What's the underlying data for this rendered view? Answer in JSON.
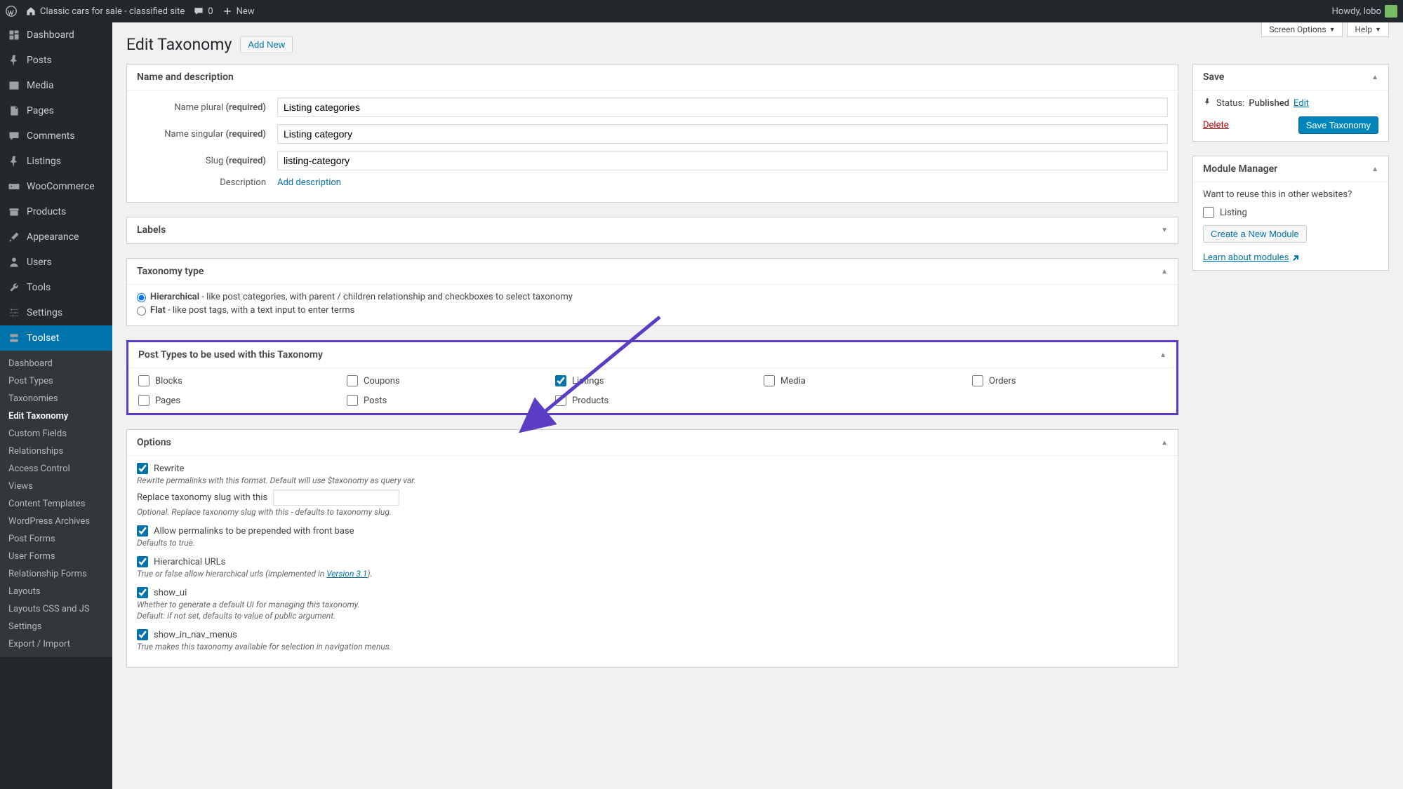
{
  "admin_bar": {
    "site_title": "Classic cars for sale - classified site",
    "comments_count": "0",
    "new_label": "New",
    "howdy": "Howdy, lobo"
  },
  "sidebar": {
    "items": [
      {
        "key": "dashboard",
        "label": "Dashboard",
        "icon": "dashboard-icon"
      },
      {
        "key": "posts",
        "label": "Posts",
        "icon": "pin-icon"
      },
      {
        "key": "media",
        "label": "Media",
        "icon": "media-icon"
      },
      {
        "key": "pages",
        "label": "Pages",
        "icon": "page-icon"
      },
      {
        "key": "comments",
        "label": "Comments",
        "icon": "comment-icon"
      },
      {
        "key": "listings",
        "label": "Listings",
        "icon": "pin-icon"
      },
      {
        "key": "woocommerce",
        "label": "WooCommerce",
        "icon": "woo-icon"
      },
      {
        "key": "products",
        "label": "Products",
        "icon": "archive-icon"
      },
      {
        "key": "appearance",
        "label": "Appearance",
        "icon": "brush-icon"
      },
      {
        "key": "users",
        "label": "Users",
        "icon": "user-icon"
      },
      {
        "key": "tools",
        "label": "Tools",
        "icon": "wrench-icon"
      },
      {
        "key": "settings",
        "label": "Settings",
        "icon": "sliders-icon"
      },
      {
        "key": "toolset",
        "label": "Toolset",
        "icon": "toolset-icon",
        "current": true
      }
    ],
    "toolset_sub": [
      "Dashboard",
      "Post Types",
      "Taxonomies",
      "Edit Taxonomy",
      "Custom Fields",
      "Relationships",
      "Access Control",
      "Views",
      "Content Templates",
      "WordPress Archives",
      "Post Forms",
      "User Forms",
      "Relationship Forms",
      "Layouts",
      "Layouts CSS and JS",
      "Settings",
      "Export / Import"
    ],
    "toolset_sub_active": "Edit Taxonomy"
  },
  "top_tabs": {
    "screen_options": "Screen Options",
    "help": "Help"
  },
  "page": {
    "title": "Edit Taxonomy",
    "add_new": "Add New"
  },
  "panels": {
    "name_desc": {
      "title": "Name and description",
      "name_plural_label": "Name plural",
      "name_singular_label": "Name singular",
      "slug_label": "Slug",
      "required": "(required)",
      "description_label": "Description",
      "add_description": "Add description",
      "values": {
        "name_plural": "Listing categories",
        "name_singular": "Listing category",
        "slug": "listing-category"
      }
    },
    "labels": {
      "title": "Labels"
    },
    "taxonomy_type": {
      "title": "Taxonomy type",
      "hierarchical_label": "Hierarchical",
      "hierarchical_desc": " - like post categories, with parent / children relationship and checkboxes to select taxonomy",
      "flat_label": "Flat",
      "flat_desc": " - like post tags, with a text input to enter terms",
      "selected": "hierarchical"
    },
    "post_types": {
      "title": "Post Types to be used with this Taxonomy",
      "items": [
        {
          "key": "blocks",
          "label": "Blocks",
          "checked": false
        },
        {
          "key": "coupons",
          "label": "Coupons",
          "checked": false
        },
        {
          "key": "listings",
          "label": "Listings",
          "checked": true
        },
        {
          "key": "media",
          "label": "Media",
          "checked": false
        },
        {
          "key": "orders",
          "label": "Orders",
          "checked": false
        },
        {
          "key": "pages",
          "label": "Pages",
          "checked": false
        },
        {
          "key": "posts",
          "label": "Posts",
          "checked": false
        },
        {
          "key": "products",
          "label": "Products",
          "checked": false
        }
      ]
    },
    "options": {
      "title": "Options",
      "rewrite": {
        "label": "Rewrite",
        "help": "Rewrite permalinks with this format. Default will use $taxonomy as query var."
      },
      "replace_slug": {
        "label": "Replace taxonomy slug with this",
        "help": "Optional. Replace taxonomy slug with this - defaults to taxonomy slug."
      },
      "front_base": {
        "label": "Allow permalinks to be prepended with front base",
        "help": "Defaults to true."
      },
      "hier_urls": {
        "label": "Hierarchical URLs",
        "help_pre": "True or false allow hierarchical urls (implemented in ",
        "version_link": "Version 3.1",
        "help_post": ")."
      },
      "show_ui": {
        "label": "show_ui",
        "help1": "Whether to generate a default UI for managing this taxonomy.",
        "help2": "Default: if not set, defaults to value of public argument."
      },
      "show_nav": {
        "label": "show_in_nav_menus",
        "help": "True makes this taxonomy available for selection in navigation menus."
      }
    }
  },
  "side": {
    "save": {
      "title": "Save",
      "status_label": "Status:",
      "status_value": "Published",
      "edit": "Edit",
      "delete": "Delete",
      "save_btn": "Save Taxonomy"
    },
    "module": {
      "title": "Module Manager",
      "prompt": "Want to reuse this in other websites?",
      "listing": "Listing",
      "create_btn": "Create a New Module",
      "learn": "Learn about modules"
    }
  }
}
